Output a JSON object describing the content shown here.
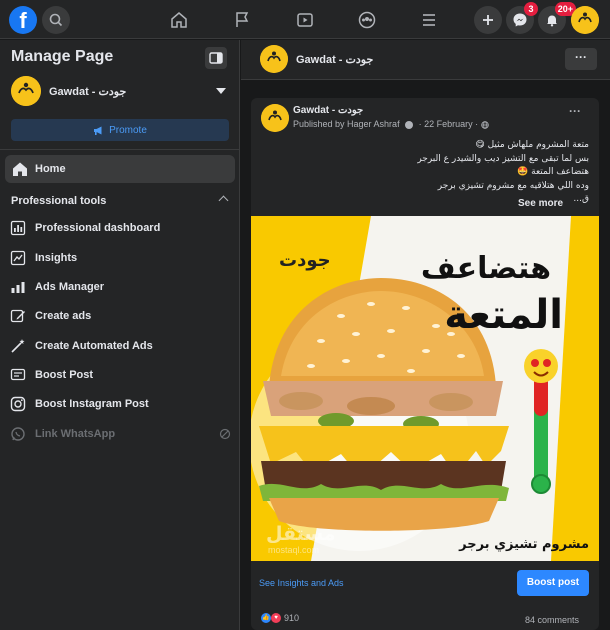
{
  "topbar": {
    "logo": "f",
    "icons": [
      "search-icon",
      "home-icon",
      "flag-icon",
      "video-icon",
      "groups-icon",
      "menu-icon",
      "plus-icon",
      "messenger-icon",
      "bell-icon"
    ],
    "messenger_badge": "3",
    "notifications_badge": "20+"
  },
  "sidebar": {
    "title": "Manage Page",
    "page_name": "Gawdat - جودت",
    "promote_label": "Promote",
    "home_label": "Home",
    "section_title": "Professional tools",
    "tools": [
      {
        "label": "Professional dashboard",
        "icon": "dashboard-icon",
        "enabled": true
      },
      {
        "label": "Insights",
        "icon": "insights-icon",
        "enabled": true
      },
      {
        "label": "Ads Manager",
        "icon": "ads-manager-icon",
        "enabled": true
      },
      {
        "label": "Create ads",
        "icon": "pencil-icon",
        "enabled": true
      },
      {
        "label": "Create Automated Ads",
        "icon": "magic-wand-icon",
        "enabled": true
      },
      {
        "label": "Boost Post",
        "icon": "boost-post-icon",
        "enabled": true
      },
      {
        "label": "Boost Instagram Post",
        "icon": "instagram-icon",
        "enabled": true
      },
      {
        "label": "Link WhatsApp",
        "icon": "whatsapp-icon",
        "enabled": false
      }
    ]
  },
  "main": {
    "header_name": "Gawdat - جودت",
    "more_label": "···",
    "post": {
      "author": "Gawdat - جودت",
      "published_by": "Published by Hager Ashraf",
      "date": "22 February",
      "text_lines": [
        "متعة المشروم ملهاش مثيل 😋",
        "بس لما تبقى مع التشيز ديب والشيدر ع البرجر",
        "هتضاعف المتعة 🤩",
        "وده اللي هتلاقيه مع مشروم تشيزي برجر",
        "ق..."
      ],
      "see_more": "See more",
      "image_headline_1": "هتضاعف",
      "image_headline_2": "المتعة",
      "image_caption": "مشروم تشيزي برجر",
      "brand_mark": "جودت",
      "cta_link": "See Insights and Ads",
      "boost_label": "Boost post",
      "reaction_count": "910",
      "comments": "84 comments"
    },
    "watermark": "مستقل",
    "watermark_sub": "mostaql.com"
  },
  "colors": {
    "accent": "#2d88ff",
    "background": "#18191a",
    "surface": "#242526",
    "brand_yellow": "#f7c21a"
  }
}
